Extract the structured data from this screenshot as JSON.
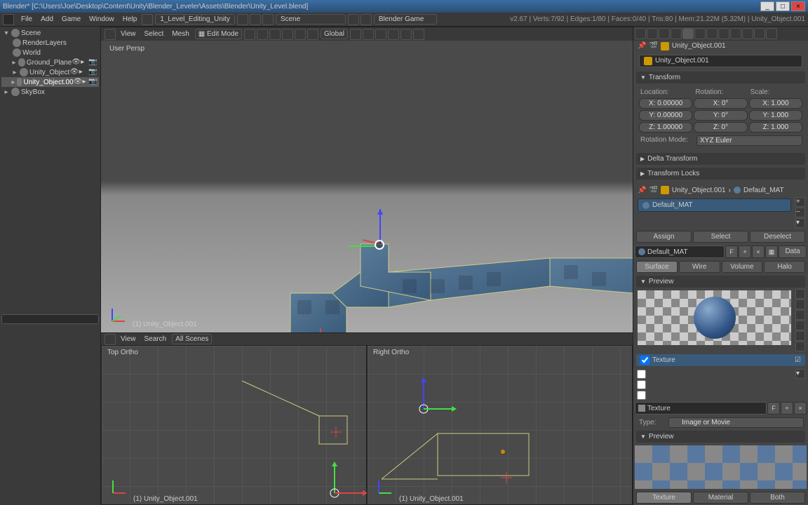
{
  "window": {
    "title": "Blender* [C:\\Users\\Joe\\Desktop\\Content\\Unity\\Blender_Leveler\\Assets\\Blender\\Unity_Level.blend]"
  },
  "menubar": {
    "file": "File",
    "add": "Add",
    "game": "Game",
    "window": "Window",
    "help": "Help",
    "layout": "1_Level_Editing_Unity",
    "scene": "Scene",
    "engine": "Blender Game",
    "stats": "v2.67 | Verts:7/92 | Edges:1/80 | Faces:0/40 | Tris:80 | Mem:21.22M (5.32M) | Unity_Object.001"
  },
  "outliner": {
    "scene": "Scene",
    "renderlayers": "RenderLayers",
    "world": "World",
    "groundplane": "Ground_Plane",
    "unityobj": "Unity_Object",
    "unityobj001": "Unity_Object.00",
    "skybox": "SkyBox"
  },
  "viewheader": {
    "view": "View",
    "select": "Select",
    "mesh": "Mesh",
    "mode": "Edit Mode",
    "orient": "Global"
  },
  "viewport": {
    "persp": "User Persp",
    "objname": "(1) Unity_Object.001",
    "topview": "Top Ortho",
    "rightview": "Right Ortho"
  },
  "views2d": {
    "header": {
      "view": "View",
      "search": "Search",
      "allscenes": "All Scenes"
    }
  },
  "props": {
    "obj_breadcrumb": "Unity_Object.001",
    "obj_name": "Unity_Object.001",
    "transform": {
      "title": "Transform",
      "location": "Location:",
      "rotation": "Rotation:",
      "scale": "Scale:",
      "lx": "X: 0.00000",
      "ly": "Y: 0.00000",
      "lz": "Z: 1.00000",
      "rx": "X: 0°",
      "ry": "Y: 0°",
      "rz": "Z: 0°",
      "sx": "X: 1.000",
      "sy": "Y: 1.000",
      "sz": "Z: 1.000",
      "rotmode_lbl": "Rotation Mode:",
      "rotmode": "XYZ Euler"
    },
    "deltatransform": "Delta Transform",
    "transformlocks": "Transform Locks",
    "mat_breadcrumb_obj": "Unity_Object.001",
    "mat_breadcrumb_mat": "Default_MAT",
    "matslot": "Default_MAT",
    "assign": "Assign",
    "select": "Select",
    "deselect": "Deselect",
    "matname": "Default_MAT",
    "f": "F",
    "data": "Data",
    "surface": "Surface",
    "wire": "Wire",
    "volume": "Volume",
    "halo": "Halo",
    "preview": "Preview",
    "texture": "Texture",
    "tex_breadcrumb": "Texture",
    "type_lbl": "Type:",
    "type": "Image or Movie",
    "texbtn": "Texture",
    "matbtn": "Material",
    "bothbtn": "Both"
  }
}
